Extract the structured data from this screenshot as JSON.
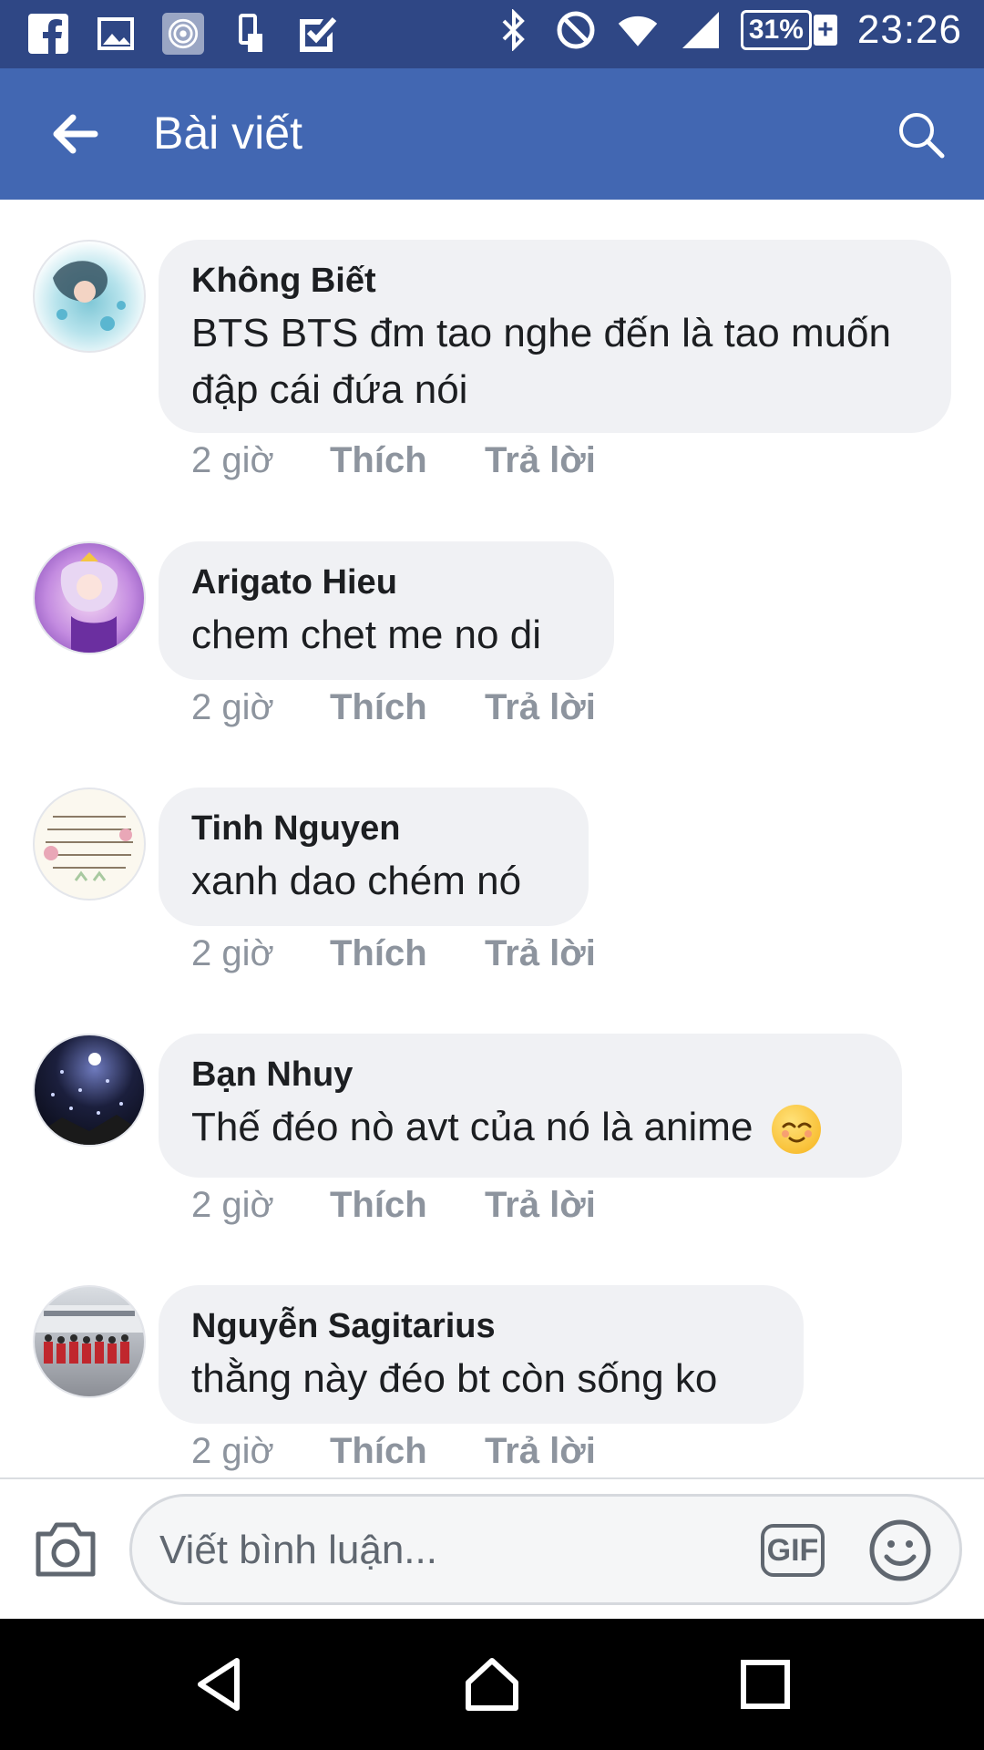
{
  "status_bar": {
    "left_icons": [
      "facebook-icon",
      "gallery-icon",
      "circle-app-icon",
      "phone-settings-icon",
      "check-icon"
    ],
    "right_icons": [
      "bluetooth-icon",
      "do-not-disturb-icon",
      "wifi-icon",
      "signal-icon"
    ],
    "battery": "31%",
    "battery_charging": "+",
    "time": "23:26"
  },
  "header": {
    "title": "Bài viết",
    "back_icon": "back-arrow-icon",
    "search_icon": "search-icon",
    "background": "#4267b2"
  },
  "comments": [
    {
      "name": "Không Biết",
      "text": "BTS BTS đm tao nghe đến là tao muốn đập cái đứa nói",
      "time": "2 giờ",
      "like": "Thích",
      "reply": "Trả lời"
    },
    {
      "name": "Arigato Hieu",
      "text": "chem chet me no di",
      "time": "2 giờ",
      "like": "Thích",
      "reply": "Trả lời"
    },
    {
      "name": "Tinh Nguyen",
      "text": "xanh dao chém nó",
      "time": "2 giờ",
      "like": "Thích",
      "reply": "Trả lời"
    },
    {
      "name": "Bạn Nhuy",
      "text": "Thế đéo nò avt của nó là anime",
      "emoji": "relieved-face-emoji",
      "time": "2 giờ",
      "like": "Thích",
      "reply": "Trả lời"
    },
    {
      "name": "Nguyễn Sagitarius",
      "text": "thằng này đéo bt còn sống ko",
      "time": "2 giờ",
      "like": "Thích",
      "reply": "Trả lời"
    }
  ],
  "compose": {
    "placeholder": "Viết bình luận...",
    "gif_label": "GIF",
    "camera_icon": "camera-icon",
    "emoji_icon": "smiley-icon"
  },
  "nav_bar": {
    "icons": [
      "back-triangle-icon",
      "home-icon",
      "recents-icon"
    ]
  }
}
